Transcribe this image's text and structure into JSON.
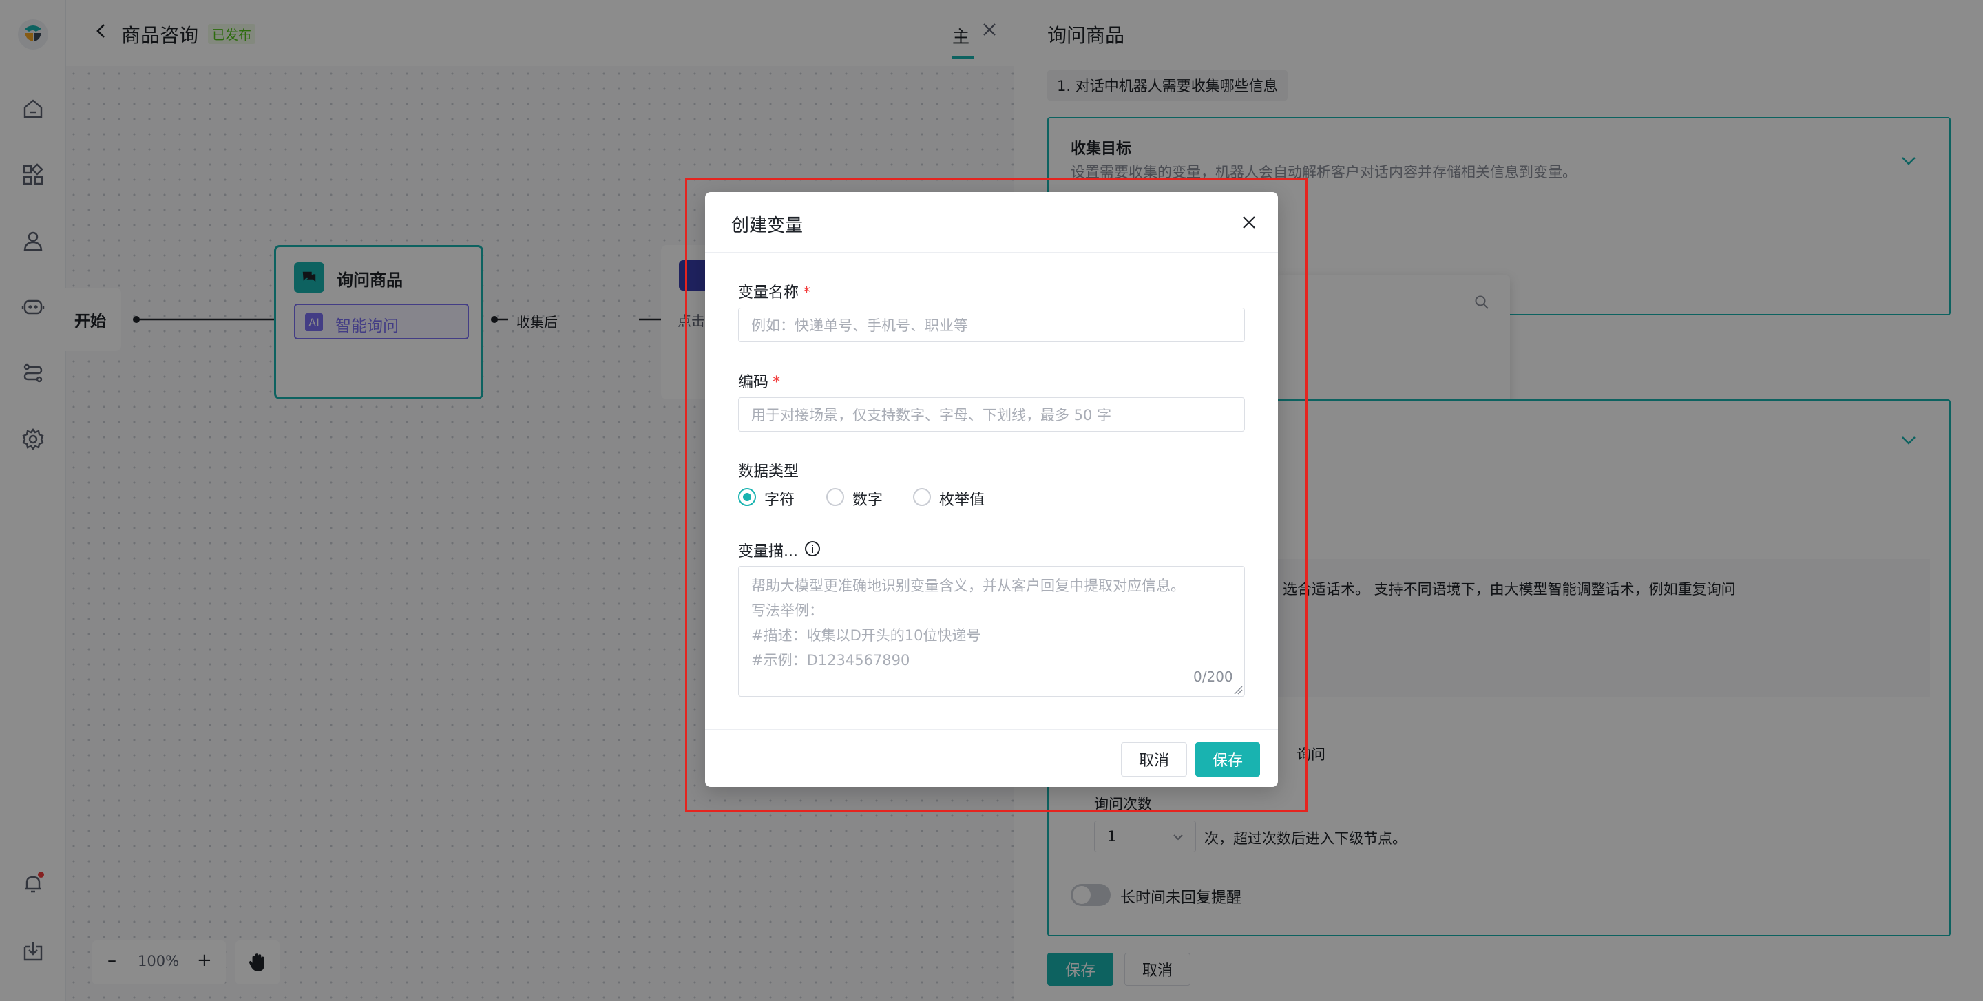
{
  "app": {
    "back_label": "商品咨询",
    "status_badge": "已发布",
    "tab_label": "主"
  },
  "canvas": {
    "start_node": "开始",
    "ask_node_title": "询问商品",
    "ask_node_chip": "智能询问",
    "ai_badge": "AI",
    "edge_label": "收集后",
    "next_node_partial": "点击",
    "zoom": "100%",
    "zoom_out": "–",
    "zoom_in": "+"
  },
  "panel": {
    "title": "询问商品",
    "step1_label": "1. 对话中机器人需要收集哪些信息",
    "collect_title": "收集目标",
    "collect_desc": "设置需要收集的变量，机器人会自动解析客户对话内容并存储相关信息到变量。",
    "behind_text": "选合适话术。 支持不同语境下，由大模型智能调整话术，例如重复询问",
    "ask_partial": "询问",
    "ask_count_label": "询问次数",
    "ask_count_value": "1",
    "ask_count_suffix": "次，超过次数后进入下级节点。",
    "toggle_label": "长时间未回复提醒",
    "save_label": "保存",
    "cancel_label": "取消"
  },
  "modal": {
    "title": "创建变量",
    "name_label": "变量名称",
    "name_placeholder": "例如：快递单号、手机号、职业等",
    "code_label": "编码",
    "code_placeholder": "用于对接场景，仅支持数字、字母、下划线，最多 50 字",
    "type_label": "数据类型",
    "type_options": [
      "字符",
      "数字",
      "枚举值"
    ],
    "type_selected": "字符",
    "desc_label": "变量描...",
    "desc_placeholder_lines": [
      "帮助大模型更准确地识别变量含义，并从客户回复中提取对应信息。",
      "写法举例：",
      "#描述：收集以D开头的10位快递号",
      "#示例：D1234567890"
    ],
    "desc_counter": "0/200",
    "required_mark": "*",
    "cancel_label": "取消",
    "save_label": "保存"
  },
  "colors": {
    "accent": "#19b3b0",
    "highlight_box": "#e5241f",
    "required": "#f23c3c",
    "badge": "#52c41a"
  }
}
